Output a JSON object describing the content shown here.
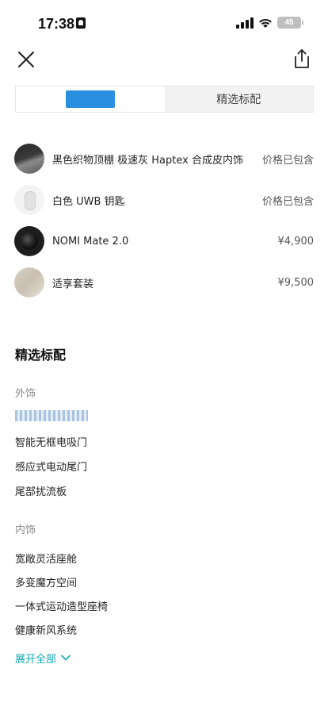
{
  "status_bar": {
    "time": "17:38",
    "battery_level": "45",
    "icons": [
      "lock-icon",
      "signal-icon",
      "wifi-icon",
      "battery-icon"
    ]
  },
  "nav": {
    "icons": [
      "close-icon",
      "share-icon"
    ]
  },
  "tabs": [
    {
      "label": "",
      "active": true
    },
    {
      "label": "精选标配",
      "active": false
    }
  ],
  "options": [
    {
      "name": "黑色织物顶棚 极速灰 Haptex 合成皮内饰",
      "price": "价格已包含"
    },
    {
      "name": "白色 UWB 钥匙",
      "price": "价格已包含"
    },
    {
      "name": "NOMI Mate 2.0",
      "price": "¥4,900"
    },
    {
      "name": "适享套装",
      "price": "¥9,500"
    }
  ],
  "standard": {
    "title": "精选标配",
    "exterior": {
      "label": "外饰",
      "items": [
        "智能无框电吸门",
        "感应式电动尾门",
        "尾部扰流板"
      ]
    },
    "interior": {
      "label": "内饰",
      "items": [
        "宽敞灵活座舱",
        "多变魔方空间",
        "一体式运动造型座椅",
        "健康新风系统"
      ]
    },
    "expand_label": "展开全部"
  },
  "colors": {
    "accent": "#13a8b4",
    "redaction": "#2b8fe0"
  }
}
